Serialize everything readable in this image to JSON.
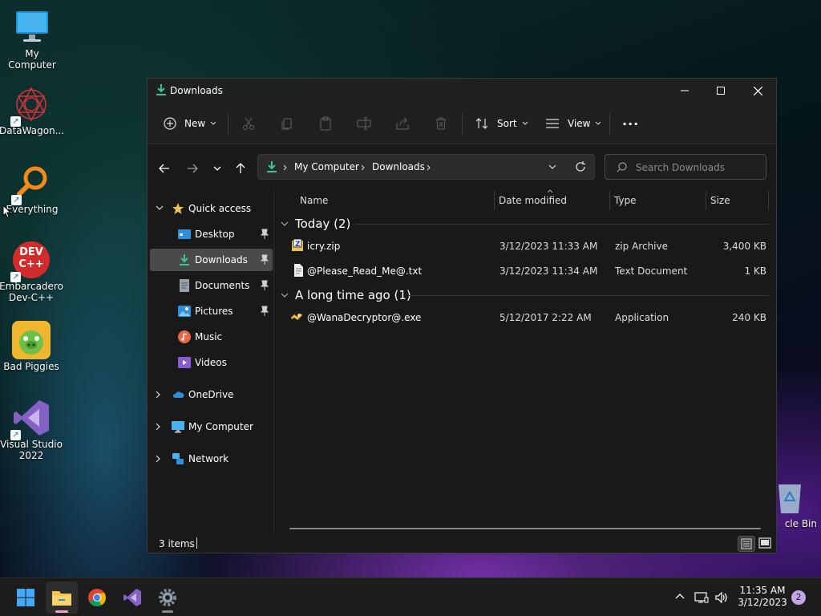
{
  "desktop": {
    "icons": [
      {
        "name": "My Computer",
        "label": "My Computer"
      },
      {
        "name": "DataWagon",
        "label": "DataWagon..."
      },
      {
        "name": "Everything",
        "label": "Everything"
      },
      {
        "name": "Embarcadero Dev-C++",
        "label": "Embarcadero Dev-C++"
      },
      {
        "name": "Bad Piggies",
        "label": "Bad Piggies"
      },
      {
        "name": "Visual Studio 2022",
        "label": "Visual Studio 2022"
      },
      {
        "name": "Recycle Bin",
        "label": "cle Bin"
      }
    ],
    "devcpp_logo_text": "DEV C++"
  },
  "window": {
    "title": "Downloads",
    "commands": {
      "new": "New",
      "sort": "Sort",
      "view": "View",
      "more": "···"
    },
    "address": {
      "crumbs": [
        "My Computer",
        "Downloads"
      ]
    },
    "search": {
      "placeholder": "Search Downloads"
    },
    "sidebar": {
      "quick_access": "Quick access",
      "items": [
        {
          "label": "Desktop",
          "pinned": true
        },
        {
          "label": "Downloads",
          "pinned": true,
          "selected": true
        },
        {
          "label": "Documents",
          "pinned": true
        },
        {
          "label": "Pictures",
          "pinned": true
        },
        {
          "label": "Music",
          "pinned": false
        },
        {
          "label": "Videos",
          "pinned": false
        }
      ],
      "roots": [
        "OneDrive",
        "My Computer",
        "Network"
      ]
    },
    "columns": {
      "name": "Name",
      "date": "Date modified",
      "type": "Type",
      "size": "Size"
    },
    "groups": [
      {
        "title": "Today (2)",
        "files": [
          {
            "name": "icry.zip",
            "date": "3/12/2023 11:33 AM",
            "type": "zip Archive",
            "size": "3,400 KB",
            "icon": "zip-icon"
          },
          {
            "name": "@Please_Read_Me@.txt",
            "date": "3/12/2023 11:34 AM",
            "type": "Text Document",
            "size": "1 KB",
            "icon": "text-file-icon"
          }
        ]
      },
      {
        "title": "A long time ago (1)",
        "files": [
          {
            "name": "@WanaDecryptor@.exe",
            "date": "5/12/2017 2:22 AM",
            "type": "Application",
            "size": "240 KB",
            "icon": "application-icon"
          }
        ]
      }
    ],
    "status": {
      "items": "3 items"
    }
  },
  "taskbar": {
    "time": "11:35 AM",
    "date": "3/12/2023",
    "notifications": "2"
  },
  "colors": {
    "accent_download": "#3fc29a",
    "folder_yellow": "#f2c14e",
    "selection": "#4a4a4a"
  }
}
